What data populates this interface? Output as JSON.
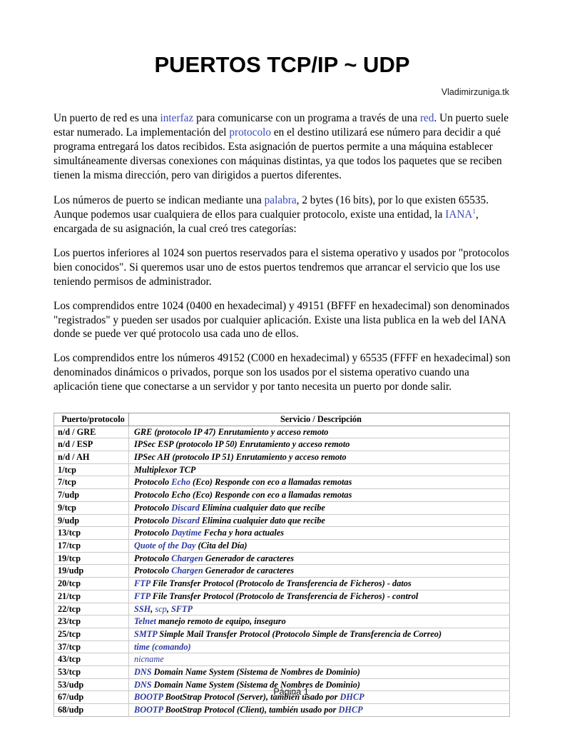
{
  "document": {
    "title": "PUERTOS TCP/IP ~ UDP",
    "byline": "Vladimirzuniga.tk",
    "footer": "Página 1"
  },
  "paragraphs": [
    {
      "id": "p1",
      "runs": [
        {
          "t": "Un puerto de red es una ",
          "link": false
        },
        {
          "t": "interfaz",
          "link": true
        },
        {
          "t": " para comunicarse con un programa a través de una ",
          "link": false
        },
        {
          "t": "red",
          "link": true
        },
        {
          "t": ". Un puerto suele estar numerado. La implementación del ",
          "link": false
        },
        {
          "t": "protocolo",
          "link": true
        },
        {
          "t": " en el destino utilizará ese número para decidir a qué programa entregará los datos recibidos. Esta asignación de puertos permite a una máquina establecer simultáneamente diversas conexiones con máquinas distintas, ya que todos los paquetes que se reciben tienen la misma dirección, pero van dirigidos a puertos diferentes.",
          "link": false
        }
      ]
    },
    {
      "id": "p2",
      "runs": [
        {
          "t": "Los números de puerto se indican mediante una ",
          "link": false
        },
        {
          "t": "palabra",
          "link": true
        },
        {
          "t": ", 2 bytes (16 bits), por lo que existen 65535. Aunque podemos usar cualquiera de ellos para cualquier protocolo, existe una entidad, la ",
          "link": false
        },
        {
          "t": "IANA",
          "link": true
        },
        {
          "t": "1",
          "sup": true
        },
        {
          "t": ", encargada de su asignación, la cual creó tres categorías:",
          "link": false
        }
      ]
    },
    {
      "id": "p3",
      "runs": [
        {
          "t": "Los puertos inferiores al 1024 son puertos reservados para el sistema operativo y usados por \"protocolos bien conocidos\". Si queremos usar uno de estos puertos tendremos que arrancar el servicio que los use teniendo permisos de administrador.",
          "link": false
        }
      ]
    },
    {
      "id": "p4",
      "runs": [
        {
          "t": "Los comprendidos entre 1024 (0400 en hexadecimal) y 49151 (BFFF en hexadecimal) son denominados \"registrados\" y pueden ser usados por cualquier aplicación. Existe una lista publica en la web del IANA donde se puede ver qué protocolo usa cada uno de ellos.",
          "link": false
        }
      ]
    },
    {
      "id": "p5",
      "runs": [
        {
          "t": "Los comprendidos entre los números 49152 (C000 en hexadecimal) y 65535 (FFFF en hexadecimal) son denominados dinámicos o privados, porque son los usados por el sistema operativo cuando una aplicación tiene que conectarse a un servidor y por tanto necesita un puerto por donde salir.",
          "link": false
        }
      ]
    }
  ],
  "table": {
    "headers": [
      "Puerto/protocolo",
      "Servicio / Descripción"
    ],
    "rows": [
      {
        "port": "n/d / GRE",
        "runs": [
          {
            "t": "GRE (protocolo IP 47) Enrutamiento y acceso remoto"
          }
        ]
      },
      {
        "port": "n/d / ESP",
        "runs": [
          {
            "t": "IPSec ESP (protocolo IP 50) Enrutamiento y acceso remoto"
          }
        ]
      },
      {
        "port": "n/d / AH",
        "runs": [
          {
            "t": "IPSec AH (protocolo IP 51) Enrutamiento y acceso remoto"
          }
        ]
      },
      {
        "port": "1/tcp",
        "runs": [
          {
            "t": "Multiplexor TCP"
          }
        ]
      },
      {
        "port": "7/tcp",
        "runs": [
          {
            "t": "Protocolo "
          },
          {
            "t": "Echo",
            "link": true
          },
          {
            "t": " (Eco) Responde con eco a llamadas remotas"
          }
        ]
      },
      {
        "port": "7/udp",
        "runs": [
          {
            "t": "Protocolo Echo (Eco) Responde con eco a llamadas remotas"
          }
        ]
      },
      {
        "port": "9/tcp",
        "runs": [
          {
            "t": "Protocolo "
          },
          {
            "t": "Discard",
            "link": true
          },
          {
            "t": " Elimina cualquier dato que recibe"
          }
        ]
      },
      {
        "port": "9/udp",
        "runs": [
          {
            "t": "Protocolo "
          },
          {
            "t": "Discard",
            "link": true
          },
          {
            "t": " Elimina cualquier dato que recibe"
          }
        ]
      },
      {
        "port": "13/tcp",
        "runs": [
          {
            "t": "Protocolo "
          },
          {
            "t": "Daytime",
            "link": true
          },
          {
            "t": " Fecha y hora actuales"
          }
        ]
      },
      {
        "port": "17/tcp",
        "runs": [
          {
            "t": "Quote of the Day",
            "link": true
          },
          {
            "t": " (Cita del Día)"
          }
        ]
      },
      {
        "port": "19/tcp",
        "runs": [
          {
            "t": "Protocolo "
          },
          {
            "t": "Chargen",
            "link": true
          },
          {
            "t": " Generador de caracteres"
          }
        ]
      },
      {
        "port": "19/udp",
        "runs": [
          {
            "t": "Protocolo "
          },
          {
            "t": "Chargen",
            "link": true
          },
          {
            "t": " Generador de caracteres"
          }
        ]
      },
      {
        "port": "20/tcp",
        "runs": [
          {
            "t": "FTP",
            "link": true
          },
          {
            "t": " File Transfer Protocol (Protocolo de Transferencia de Ficheros) - datos"
          }
        ]
      },
      {
        "port": "21/tcp",
        "runs": [
          {
            "t": "FTP",
            "link": true
          },
          {
            "t": " File Transfer Protocol (Protocolo de Transferencia de Ficheros) - control"
          }
        ]
      },
      {
        "port": "22/tcp",
        "runs": [
          {
            "t": "SSH",
            "link": true
          },
          {
            "t": ", "
          },
          {
            "t": "scp",
            "link": true,
            "thin": true
          },
          {
            "t": ", "
          },
          {
            "t": "SFTP",
            "link": true
          }
        ]
      },
      {
        "port": "23/tcp",
        "runs": [
          {
            "t": "Telnet",
            "link": true
          },
          {
            "t": " manejo remoto de equipo, inseguro"
          }
        ]
      },
      {
        "port": "25/tcp",
        "runs": [
          {
            "t": "SMTP",
            "link": true
          },
          {
            "t": " Simple Mail Transfer Protocol (Protocolo Simple de Transferencia de Correo)"
          }
        ]
      },
      {
        "port": "37/tcp",
        "runs": [
          {
            "t": "time (comando)",
            "link": true
          }
        ]
      },
      {
        "port": "43/tcp",
        "runs": [
          {
            "t": "nicname",
            "link": true,
            "thin": true
          }
        ]
      },
      {
        "port": "53/tcp",
        "runs": [
          {
            "t": "DNS",
            "link": true
          },
          {
            "t": " Domain Name System (Sistema de Nombres de Dominio)"
          }
        ]
      },
      {
        "port": "53/udp",
        "runs": [
          {
            "t": "DNS",
            "link": true
          },
          {
            "t": " Domain Name System (Sistema de Nombres de Dominio)"
          }
        ]
      },
      {
        "port": "67/udp",
        "runs": [
          {
            "t": "BOOTP",
            "link": true
          },
          {
            "t": " BootStrap Protocol (Server), también usado por "
          },
          {
            "t": "DHCP",
            "link": true
          }
        ]
      },
      {
        "port": "68/udp",
        "runs": [
          {
            "t": "BOOTP",
            "link": true
          },
          {
            "t": " BootStrap Protocol (Client), también usado por "
          },
          {
            "t": "DHCP",
            "link": true
          }
        ]
      }
    ]
  },
  "colors": {
    "paragraph_link": "#3a4bbd",
    "table_link": "#2b3a9e",
    "text": "#000000",
    "table_border": "#c9c9c9"
  }
}
